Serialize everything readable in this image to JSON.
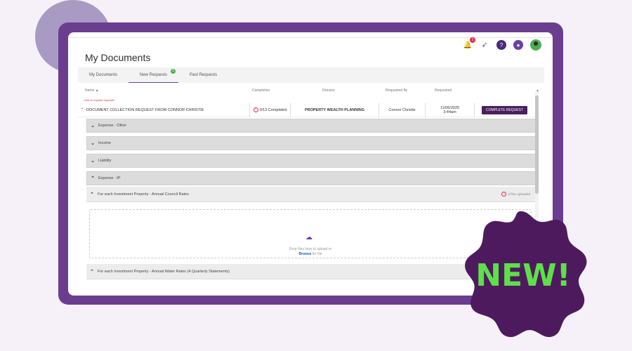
{
  "app": {
    "page_title": "My Documents",
    "notification_count": "1"
  },
  "tabs": [
    {
      "label": "My Documents"
    },
    {
      "label": "New Requests",
      "badge": "1"
    },
    {
      "label": "Past Requests"
    }
  ],
  "columns": {
    "name": "Name ▲",
    "completion": "Completion",
    "division": "Division",
    "requested_by": "Requested By",
    "requested": "Requested"
  },
  "expired_link": "Click to expired requests",
  "request": {
    "title": "DOCUMENT COLLECTION REQUEST FROM CONNOR CHRISTIE",
    "completion": "0/13 Completed",
    "division": "PROPERTY WEALTH PLANNING",
    "requested_by": "Connor Christie",
    "requested_date": "11/06/2025",
    "requested_time": "3:44am",
    "action": "COMPLETE REQUEST"
  },
  "sections": [
    {
      "label": "Expense - Other",
      "expanded": false
    },
    {
      "label": "Income",
      "expanded": false
    },
    {
      "label": "Liability",
      "expanded": false
    },
    {
      "label": "Expense - IP",
      "expanded": true
    }
  ],
  "subsections": [
    {
      "label": "For each Investment Property - Annual Council Rates",
      "status": "0 files uploaded"
    },
    {
      "label": "For each Investment Property - Annual Water Rates (4 Quarterly Statements)"
    }
  ],
  "dropzone": {
    "line1": "Drop files here to upload or",
    "browse": "Browse",
    "line2_suffix": " for file"
  },
  "badge": {
    "text": "NEW!",
    "fill": "#4e1a5e",
    "text_color": "#5ee04a"
  },
  "colors": {
    "frame": "#6b3d8f",
    "accent": "#4a1f5e",
    "background": "#f6f1f8"
  }
}
